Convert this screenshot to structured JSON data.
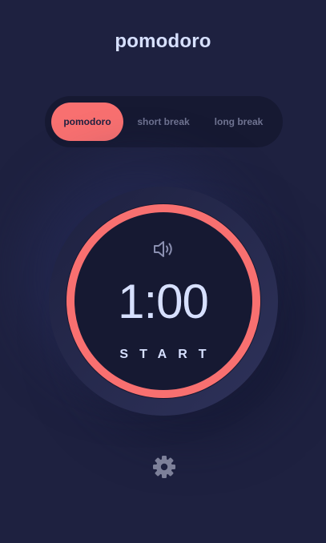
{
  "header": {
    "title": "pomodoro"
  },
  "modes": {
    "pomodoro_label": "pomodoro",
    "short_break_label": "short break",
    "long_break_label": "long break",
    "selected": "pomodoro"
  },
  "timer": {
    "time": "1:00",
    "action_label": "START",
    "progress": 1.0
  },
  "icons": {
    "sound": "speaker-icon",
    "settings": "gear-icon"
  },
  "colors": {
    "background": "#1e2140",
    "panel": "#161932",
    "accent": "#f87070",
    "text": "#d7e0ff",
    "muted": "#6f7391"
  }
}
